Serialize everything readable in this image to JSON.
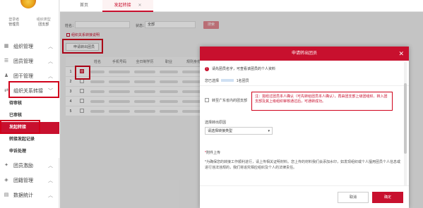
{
  "sidebar": {
    "user": [
      {
        "label": "登录者",
        "value": "管理员"
      },
      {
        "label": "组织类型",
        "value": "团支部"
      }
    ],
    "menu": [
      {
        "label": "组织管理",
        "icon": "org-icon"
      },
      {
        "label": "团员管理",
        "icon": "member-icon"
      },
      {
        "label": "团干管理",
        "icon": "cadre-icon"
      },
      {
        "label": "组织关系转接",
        "icon": "transfer-icon"
      },
      {
        "label": "团员激励",
        "icon": "reward-icon"
      },
      {
        "label": "团籍管理",
        "icon": "status-icon"
      },
      {
        "label": "数据统计",
        "icon": "stats-icon"
      }
    ],
    "submenu": [
      "待审核",
      "已审核",
      "发起转接",
      "转接发起记录",
      "申诉处理"
    ]
  },
  "tabs": {
    "home": "首页",
    "current": "发起转接"
  },
  "filter": {
    "name_label": "姓名：",
    "status_label": "状态：",
    "status_value": "全部",
    "search": "搜索"
  },
  "tip": "组织关系转接说明",
  "apply_button": "申请转出团员",
  "table": {
    "headers": [
      "",
      "姓名",
      "手机号码",
      "全日制学历",
      "职业",
      "规则身份"
    ],
    "row_numbers": [
      "1",
      "2",
      "3",
      "4",
      "5"
    ]
  },
  "modal": {
    "title": "申请转出团员",
    "warn": "请先团员名字，可查看该团员的个人资料",
    "selected_prefix": "您已选择",
    "selected_suffix": "1名团员",
    "checkbox_label": "转至广东省内的团支部",
    "notice": "注：需经过团员本人确认（可先转给团员本人确认），再由团支部上级团组织、转入团支部及其上级组织审核通过后，可通转成功。",
    "reason_label": "选择转出原因",
    "reason_value": "请选择转接类型",
    "attach_label": "附件上传",
    "attach_desc": "*为确保您的转接工作顺利进行，请上传相关证明材料。您上传的材料我们会添加水印，如发现组织或个人擅用团员个人信息或进行违法违规的，我们将追究相应组织及个人的法律责任。",
    "cancel": "取消",
    "ok": "确定"
  },
  "colors": {
    "accent": "#c8102e"
  }
}
